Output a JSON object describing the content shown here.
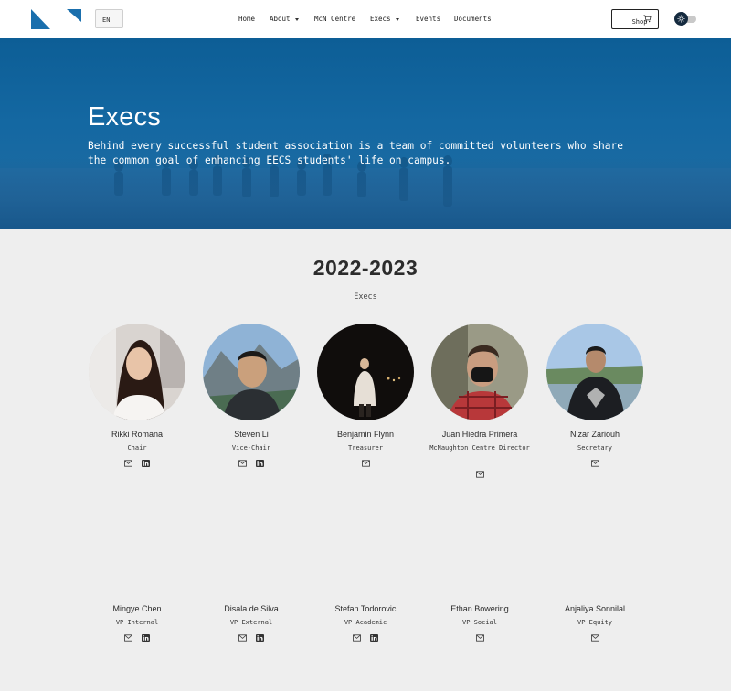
{
  "nav": {
    "language": "EN",
    "links": {
      "home": "Home",
      "about": "About",
      "mcn_centre": "McN Centre",
      "execs": "Execs",
      "events": "Events",
      "documents": "Documents"
    },
    "shop": "Shop",
    "icons": {
      "logo": "eecs-triangle-logo",
      "cart": "cart-icon",
      "theme": "sun-icon"
    },
    "colors": {
      "logo": "#1a6fad",
      "toggle_knob": "#152a3f"
    }
  },
  "hero": {
    "title": "Execs",
    "text": "Behind every successful student association is a team of committed volunteers who share the common goal of enhancing EECS students' life on campus.",
    "colors": {
      "overlay": "#1468a2"
    }
  },
  "main": {
    "year": "2022-2023",
    "section_label": "Execs",
    "execs": [
      {
        "name": "Rikki Romana",
        "role": "Chair",
        "email": true,
        "linkedin": true
      },
      {
        "name": "Steven Li",
        "role": "Vice-Chair",
        "email": true,
        "linkedin": true
      },
      {
        "name": "Benjamin Flynn",
        "role": "Treasurer",
        "email": true,
        "linkedin": false
      },
      {
        "name": "Juan Hiedra Primera",
        "role": "McNaughton Centre Director",
        "email": true,
        "linkedin": false
      },
      {
        "name": "Nizar Zariouh",
        "role": "Secretary",
        "email": true,
        "linkedin": false
      },
      {
        "name": "Mingye Chen",
        "role": "VP Internal",
        "email": true,
        "linkedin": true
      },
      {
        "name": "Disala de Silva",
        "role": "VP External",
        "email": true,
        "linkedin": true
      },
      {
        "name": "Stefan Todorovic",
        "role": "VP Academic",
        "email": true,
        "linkedin": true
      },
      {
        "name": "Ethan Bowering",
        "role": "VP Social",
        "email": true,
        "linkedin": false
      },
      {
        "name": "Anjaliya Sonnilal",
        "role": "VP Equity",
        "email": true,
        "linkedin": false
      }
    ]
  }
}
